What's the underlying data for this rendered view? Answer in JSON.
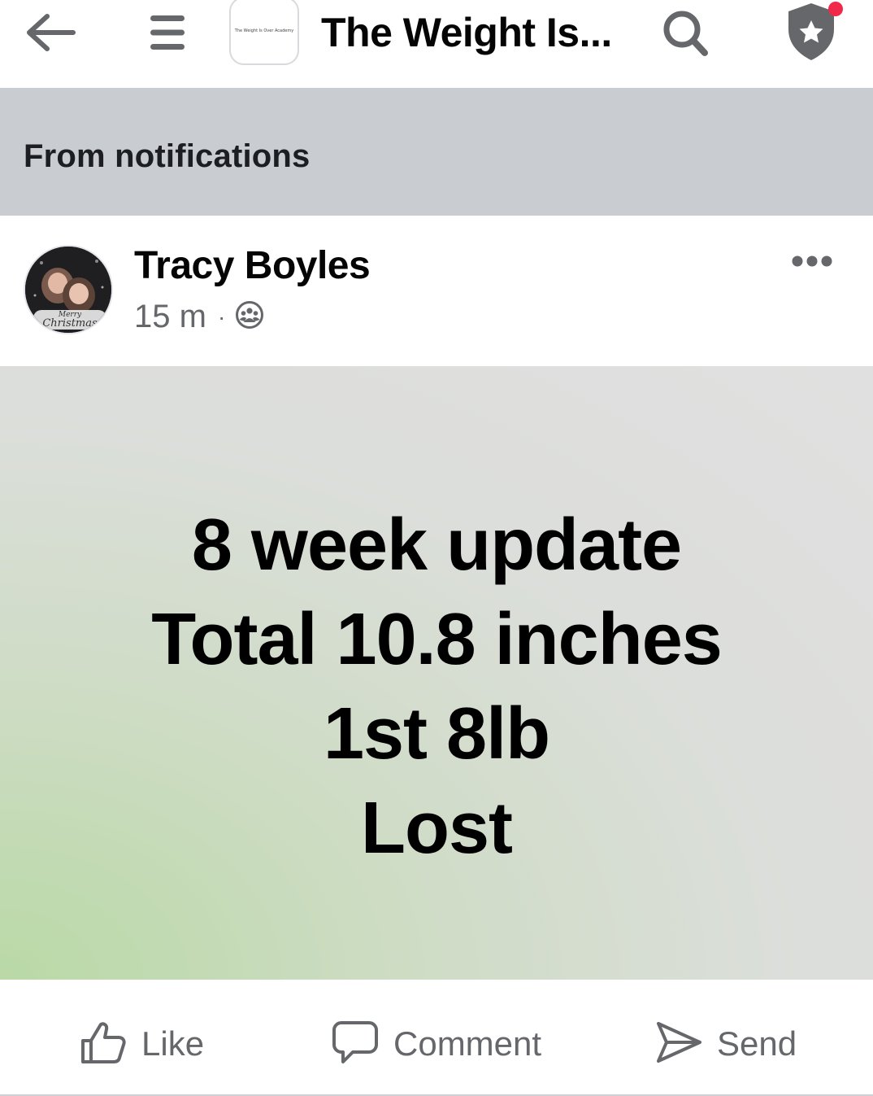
{
  "topbar": {
    "group_logo_text": "The Weight Is Over Academy",
    "group_title": "The Weight Is...",
    "icons": [
      "back-arrow-icon",
      "menu-icon",
      "search-icon",
      "shield-star-icon"
    ],
    "notification_dot_color": "#f02849"
  },
  "notification_banner": {
    "text": "From notifications"
  },
  "post": {
    "author": "Tracy Boyles",
    "time": "15 m",
    "separator": "·",
    "privacy_icon": "group-members-icon",
    "avatar_caption": "Merry Christmas",
    "body_lines": [
      "8 week update",
      "Total 10.8 inches",
      "1st 8lb",
      "Lost"
    ]
  },
  "actions": {
    "like": "Like",
    "comment": "Comment",
    "send": "Send"
  }
}
